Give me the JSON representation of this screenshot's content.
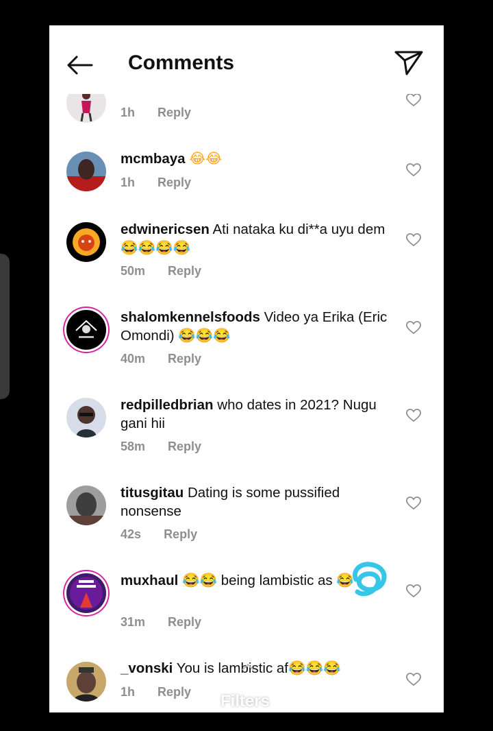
{
  "header": {
    "title": "Comments"
  },
  "comments": [
    {
      "user": "",
      "text": "",
      "time": "1h",
      "reply": "Reply"
    },
    {
      "user": "mcmbaya",
      "text": "😂😂",
      "time": "1h",
      "reply": "Reply"
    },
    {
      "user": "edwinericsen",
      "text": "Ati nataka ku di**a uyu dem😂😂😂😂",
      "time": "50m",
      "reply": "Reply"
    },
    {
      "user": "shalomkennelsfoods",
      "text": "Video ya Erika (Eric Omondi) 😂😂😂",
      "time": "40m",
      "reply": "Reply"
    },
    {
      "user": "redpilledbrian",
      "text": "who dates in 2021? Nugu gani hii",
      "time": "58m",
      "reply": "Reply"
    },
    {
      "user": "titusgitau",
      "text": "Dating is some pussified nonsense",
      "time": "42s",
      "reply": "Reply"
    },
    {
      "user": "muxhaul",
      "text": "😂😂 being lambistic as 😂",
      "time": "31m",
      "reply": "Reply"
    },
    {
      "user": "_vonski",
      "text": "You is lambistic af😂😂😂",
      "time": "1h",
      "reply": "Reply"
    }
  ],
  "overlay": {
    "filters_label": "Filters"
  },
  "colors": {
    "story_ring": "#d6249f",
    "scribble": "#38c6e8",
    "meta_text": "#8e8e8e"
  }
}
